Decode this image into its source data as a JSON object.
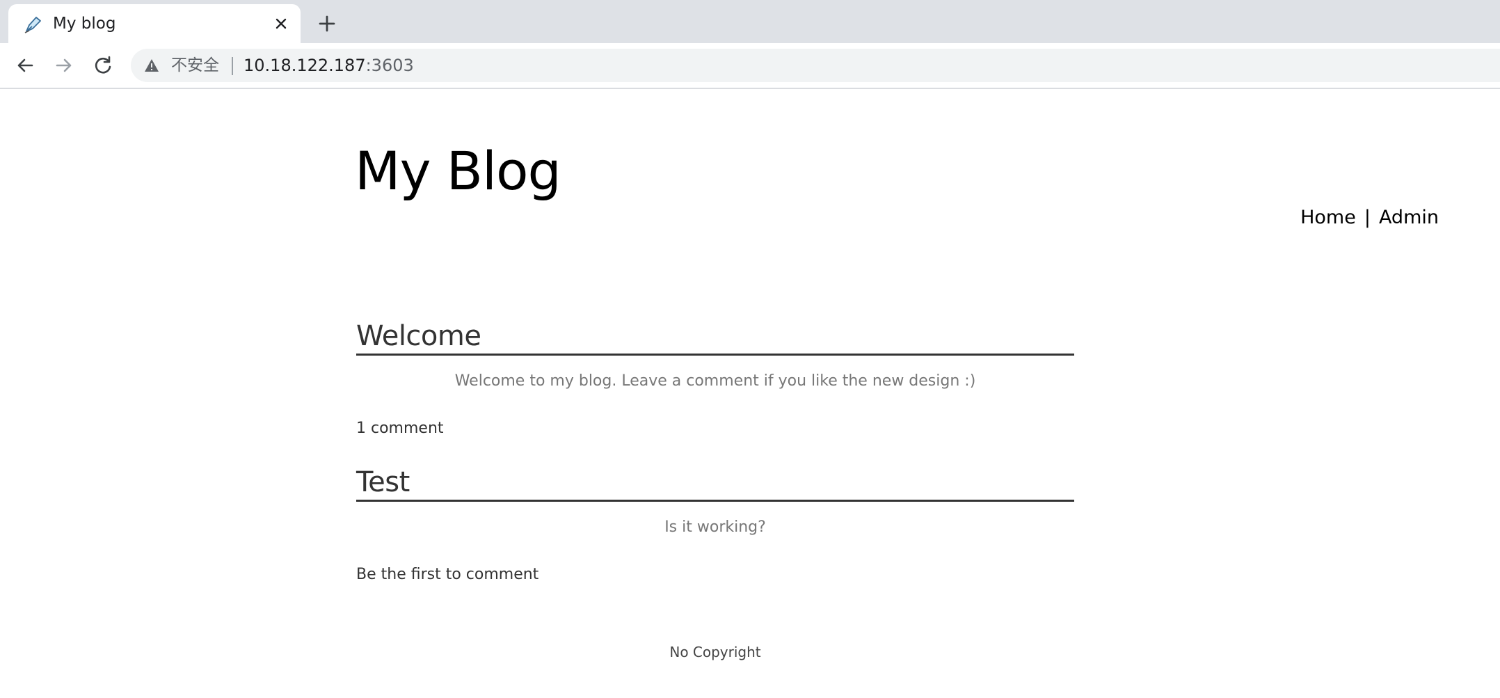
{
  "browser": {
    "tab": {
      "title": "My blog",
      "favicon": "quill-pen-icon"
    },
    "omnibox": {
      "security_label": "不安全",
      "url_host": "10.18.122.187",
      "url_port": ":3603"
    }
  },
  "site": {
    "title": "My Blog",
    "nav": [
      {
        "label": "Home"
      },
      {
        "label": "Admin"
      }
    ],
    "nav_separator": "|"
  },
  "posts": [
    {
      "title": "Welcome",
      "body": "Welcome to my blog. Leave a comment if you like the new design :)",
      "comments": "1 comment"
    },
    {
      "title": "Test",
      "body": "Is it working?",
      "comments": "Be the first to comment"
    }
  ],
  "footer": {
    "text": "No Copyright"
  }
}
